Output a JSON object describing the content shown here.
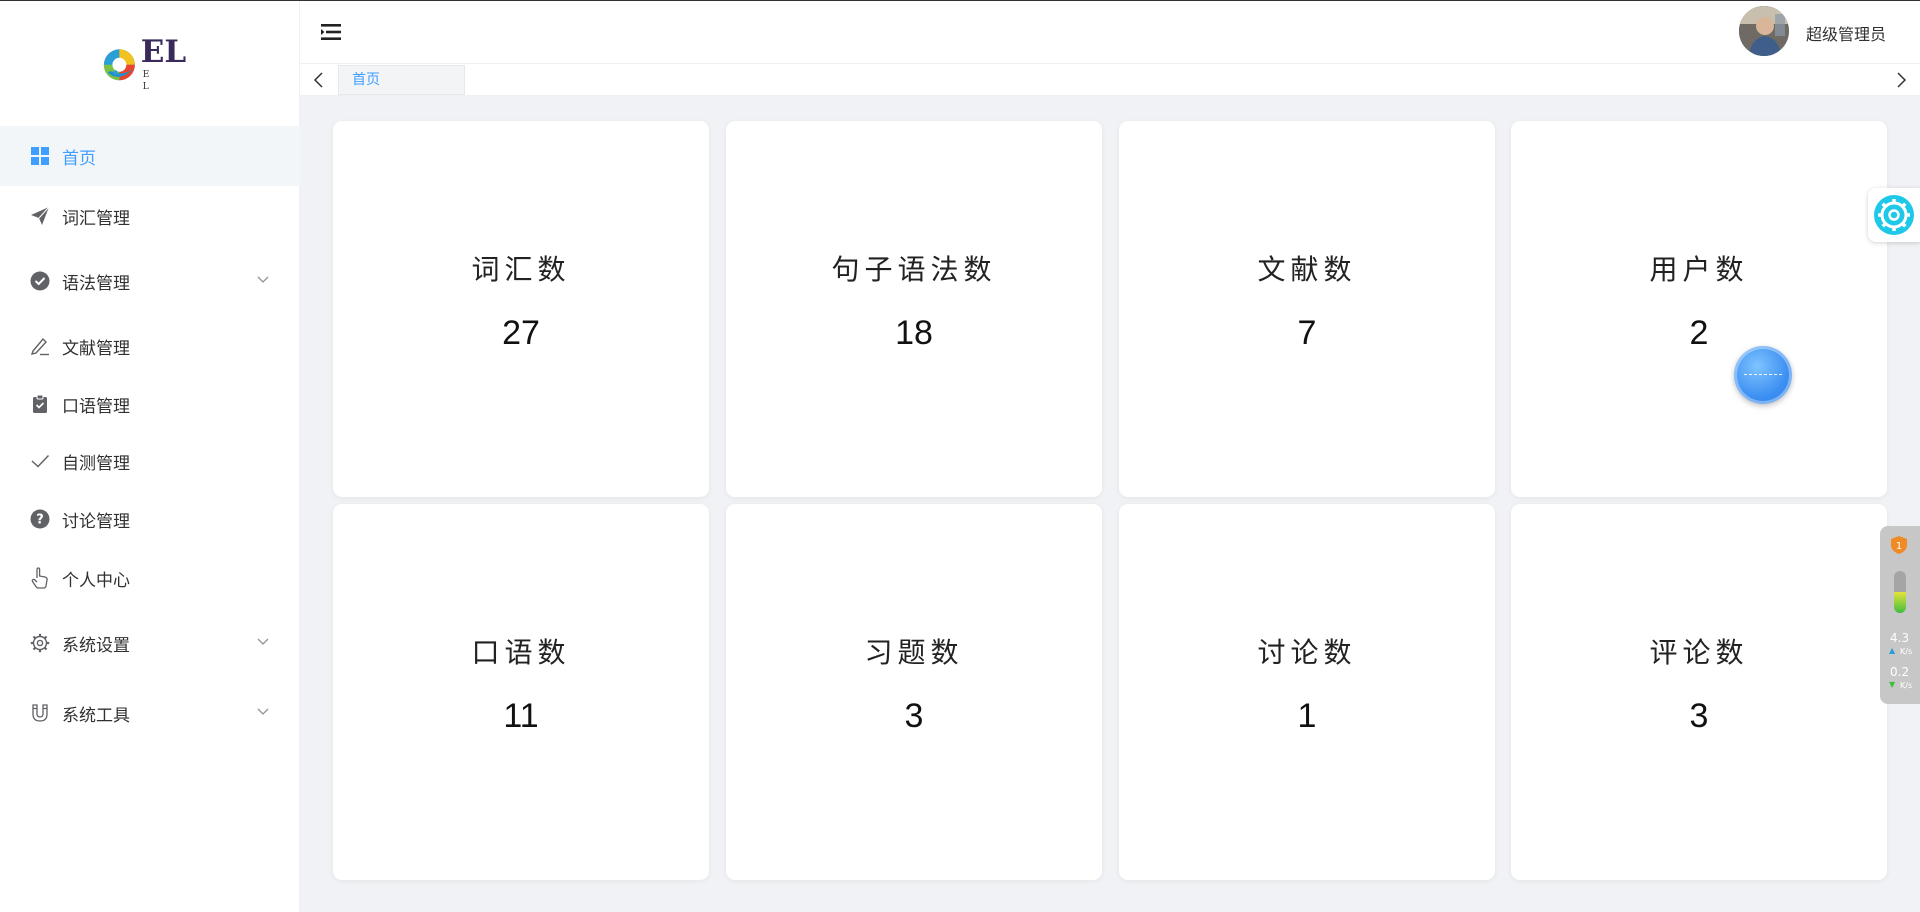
{
  "brand": {
    "logo_text": "EL",
    "logo_sub": "E L"
  },
  "sidebar": {
    "items": [
      {
        "label": "首页",
        "icon": "grid-icon",
        "active": true
      },
      {
        "label": "词汇管理",
        "icon": "paper-plane-icon"
      },
      {
        "label": "语法管理",
        "icon": "check-circle-icon",
        "has_children": true
      },
      {
        "label": "文献管理",
        "icon": "edit-pen-icon"
      },
      {
        "label": "口语管理",
        "icon": "clipboard-icon"
      },
      {
        "label": "自测管理",
        "icon": "checkmark-icon"
      },
      {
        "label": "讨论管理",
        "icon": "question-circle-icon"
      },
      {
        "label": "个人中心",
        "icon": "hand-pointer-icon"
      },
      {
        "label": "系统设置",
        "icon": "gear-icon",
        "has_children": true
      },
      {
        "label": "系统工具",
        "icon": "magnet-icon",
        "has_children": true
      }
    ]
  },
  "header": {
    "username": "超级管理员"
  },
  "tabs": [
    {
      "label": "首页",
      "active": true
    }
  ],
  "stats": [
    {
      "title": "词汇数",
      "value": "27"
    },
    {
      "title": "句子语法数",
      "value": "18"
    },
    {
      "title": "文献数",
      "value": "7"
    },
    {
      "title": "用户数",
      "value": "2"
    },
    {
      "title": "口语数",
      "value": "11"
    },
    {
      "title": "习题数",
      "value": "3"
    },
    {
      "title": "讨论数",
      "value": "1"
    },
    {
      "title": "评论数",
      "value": "3"
    }
  ],
  "net_widget": {
    "badge": "1",
    "upload_speed": "4.3",
    "upload_unit": "K/s",
    "download_speed": "0.2",
    "download_unit": "K/s",
    "gauge_level": 0.5
  },
  "colors": {
    "accent": "#409eff",
    "main_bg": "#f0f2f5",
    "active_menu_bg": "#f3f6f8"
  }
}
